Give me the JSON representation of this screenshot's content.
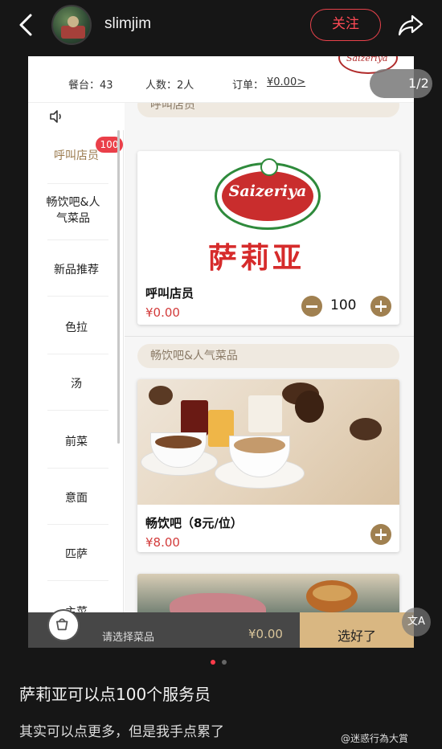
{
  "header": {
    "username": "slimjim",
    "follow_label": "关注",
    "back_icon": "chevron-left-icon",
    "share_icon": "share-arrow-icon"
  },
  "screenshot": {
    "table_label": "餐台：43",
    "people_label": "人数：2人",
    "order_label": "订单：",
    "order_value": "¥0.00>",
    "pager": "1/2",
    "categories": [
      {
        "label": "呼叫店员",
        "active": true,
        "badge": "100"
      },
      {
        "label": "畅饮吧&人气菜品"
      },
      {
        "label": "新品推荐"
      },
      {
        "label": "色拉"
      },
      {
        "label": "汤"
      },
      {
        "label": "前菜"
      },
      {
        "label": "意面"
      },
      {
        "label": "匹萨"
      },
      {
        "label": "主菜"
      }
    ],
    "section_top": "呼叫店员",
    "section_drinks": "畅饮吧&人气菜品",
    "items": [
      {
        "name": "呼叫店员",
        "price": "¥0.00",
        "qty": "100",
        "logo_text": "Saizeriya",
        "logo_cn": "萨莉亚"
      },
      {
        "name": "畅饮吧（8元/位）",
        "price": "¥8.00"
      }
    ],
    "bottom": {
      "hint": "请选择菜品",
      "total": "¥0.00",
      "done_label": "选好了"
    },
    "translate_label": "文A",
    "colors": {
      "accent": "#a08050",
      "price": "#d23a3a",
      "done": "#d9b782"
    }
  },
  "caption": {
    "title": "萨莉亚可以点100个服务员",
    "subtitle": "其实可以点更多，但是我手点累了"
  },
  "watermark": "@迷惑行為大賞"
}
